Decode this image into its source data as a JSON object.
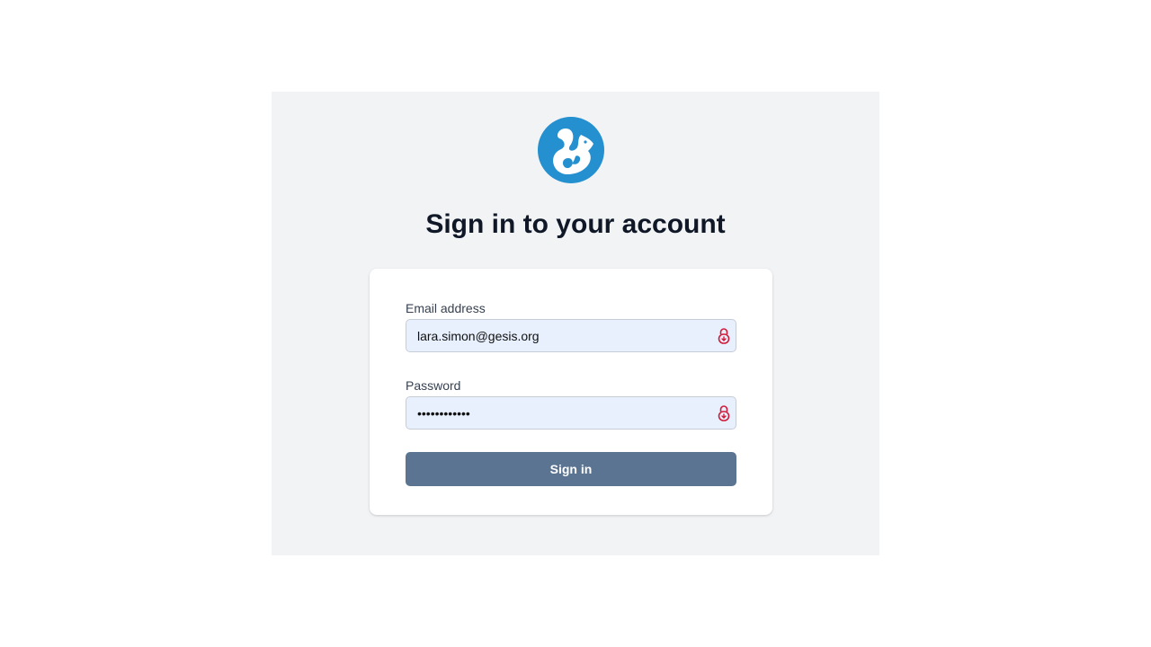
{
  "brand": {
    "logo_icon": "squirrel-logo-icon",
    "accent": "#2490cf"
  },
  "heading": "Sign in to your account",
  "form": {
    "email_label": "Email address",
    "email_value": "lara.simon@gesis.org",
    "password_label": "Password",
    "password_value": "••••••••••••",
    "password_manager_icon": "password-manager-lock-icon",
    "submit_label": "Sign in",
    "submit_color": "#5a7491",
    "autofill_color": "#e8f0fe",
    "icon_color": "#d11a3a"
  }
}
